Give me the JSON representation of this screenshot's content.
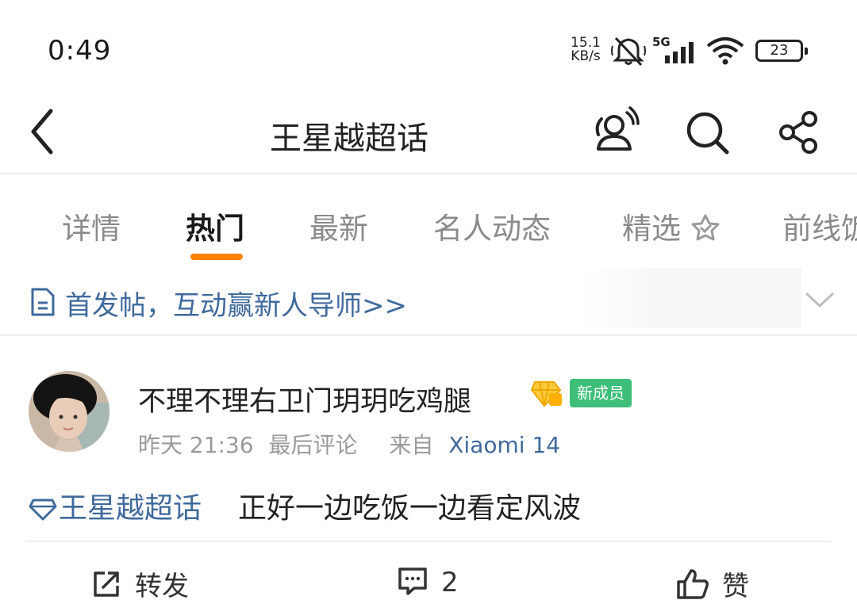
{
  "status_bar": {
    "time": "0:49",
    "net_speed_value": "15.1",
    "net_speed_unit": "KB/s",
    "network": "5G",
    "battery": "23",
    "icons": [
      "mute-icon",
      "signal-icon",
      "wifi-icon",
      "battery-icon"
    ]
  },
  "nav": {
    "title": "王星越超话",
    "icons": [
      "back-icon",
      "people-icon",
      "search-icon",
      "share-icon"
    ]
  },
  "tabs": [
    {
      "label": "详情"
    },
    {
      "label": "热门",
      "active": true
    },
    {
      "label": "最新"
    },
    {
      "label": "名人动态"
    },
    {
      "label": "精选"
    },
    {
      "label": "前线饭"
    }
  ],
  "notice": {
    "text": "首发帖，互动赢新人导师>>"
  },
  "post": {
    "username": "不理不理右卫门玥玥吃鸡腿",
    "badge": "新成员",
    "time": "昨天 21:36",
    "meta_note": "最后评论",
    "source_prefix": "来自",
    "device": "Xiaomi 14",
    "topic": "王星越超话",
    "content": "正好一边吃饭一边看定风波"
  },
  "actions": {
    "repost_label": "转发",
    "comment_count": "2",
    "like_label": "赞"
  },
  "colors": {
    "accent": "#ff8200",
    "link": "#3f6a9c",
    "badge_green": "#3dbf7a"
  }
}
